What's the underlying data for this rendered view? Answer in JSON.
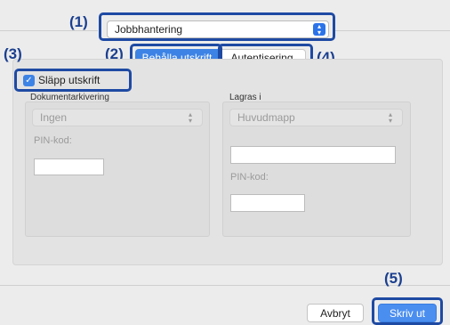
{
  "header": {
    "preset_popup_value": "Jobbhantering"
  },
  "tabs": [
    {
      "label": "Behålla utskrift",
      "selected": true
    },
    {
      "label": "Autentisering",
      "selected": false
    }
  ],
  "release_print": {
    "label": "Släpp utskrift",
    "checked": true
  },
  "document_filing": {
    "heading": "Dokumentarkivering",
    "select_value": "Ingen",
    "pin_label": "PIN-kod:",
    "pin_value": ""
  },
  "store_in": {
    "heading": "Lagras i",
    "select_value": "Huvudmapp",
    "text_value": "",
    "pin_label": "PIN-kod:",
    "pin_value": ""
  },
  "footer": {
    "cancel_label": "Avbryt",
    "print_label": "Skriv ut"
  },
  "callouts": {
    "c1": "(1)",
    "c2": "(2)",
    "c3": "(3)",
    "c4": "(4)",
    "c5": "(5)"
  },
  "colors": {
    "accent": "#3d83e6",
    "callout_frame": "#1e4aa3",
    "callout_text": "#1b3f8f"
  }
}
